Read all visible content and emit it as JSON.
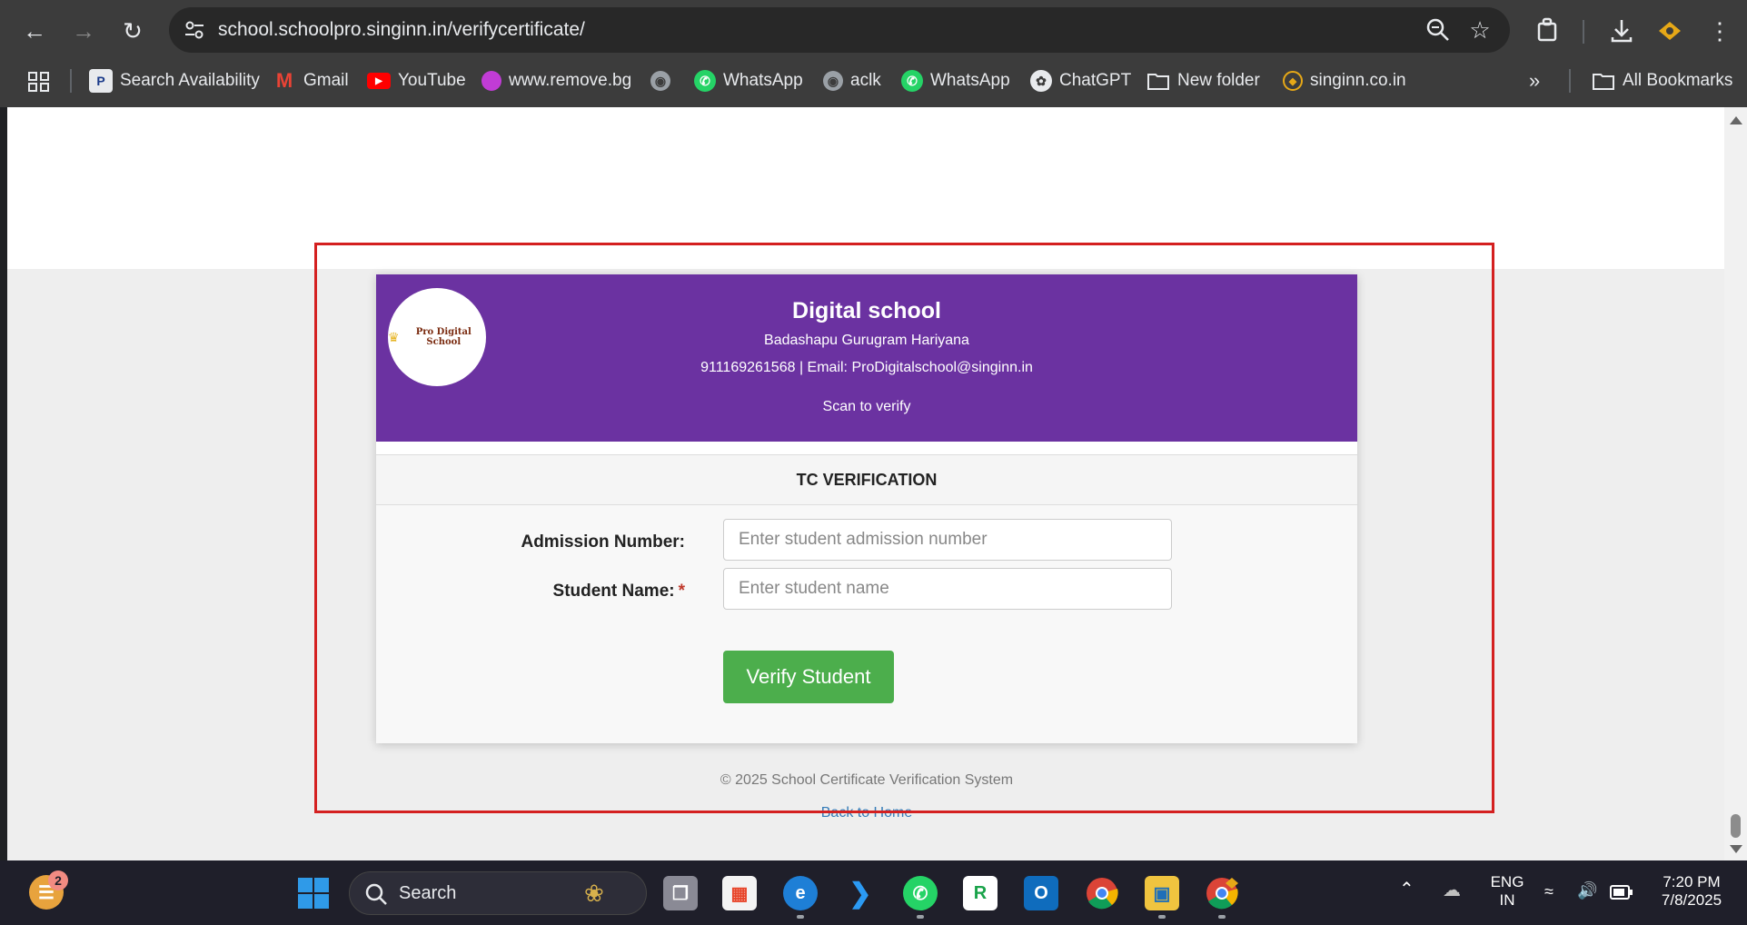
{
  "browser": {
    "url": "school.schoolpro.singinn.in/verifycertificate/",
    "bookmarks": [
      {
        "label": "Search Availability",
        "icon": "search-availability-icon"
      },
      {
        "label": "Gmail",
        "icon": "gmail-icon"
      },
      {
        "label": "YouTube",
        "icon": "youtube-icon"
      },
      {
        "label": "www.remove.bg",
        "icon": "removebg-icon"
      },
      {
        "label": "",
        "icon": "globe-icon"
      },
      {
        "label": "WhatsApp",
        "icon": "whatsapp-icon"
      },
      {
        "label": "aclk",
        "icon": "globe-icon"
      },
      {
        "label": "WhatsApp",
        "icon": "whatsapp-icon"
      },
      {
        "label": "ChatGPT",
        "icon": "chatgpt-icon"
      },
      {
        "label": "New folder",
        "icon": "folder-icon"
      },
      {
        "label": "singinn.co.in",
        "icon": "singinn-icon"
      }
    ],
    "all_bookmarks": "All Bookmarks"
  },
  "school": {
    "logo_text": "Pro Digital School",
    "name": "Digital school",
    "address": "Badashapu Gurugram Hariyana",
    "contact": "911169261568 | Email: ProDigitalschool@singinn.in",
    "scan_text": "Scan to verify"
  },
  "form": {
    "section_title": "TC VERIFICATION",
    "admission_label": "Admission Number:",
    "admission_placeholder": "Enter student admission number",
    "name_label": "Student Name:",
    "required_mark": "*",
    "name_placeholder": "Enter student name",
    "submit_label": "Verify Student"
  },
  "footer": {
    "copyright": "© 2025 School Certificate Verification System",
    "back_link": "Back to Home"
  },
  "taskbar": {
    "notification_count": "2",
    "search_label": "Search",
    "language_top": "ENG",
    "language_bottom": "IN",
    "time": "7:20 PM",
    "date": "7/8/2025"
  },
  "colors": {
    "header_purple": "#6b32a1",
    "button_green": "#4cae4c",
    "highlight_red": "#d42020"
  }
}
